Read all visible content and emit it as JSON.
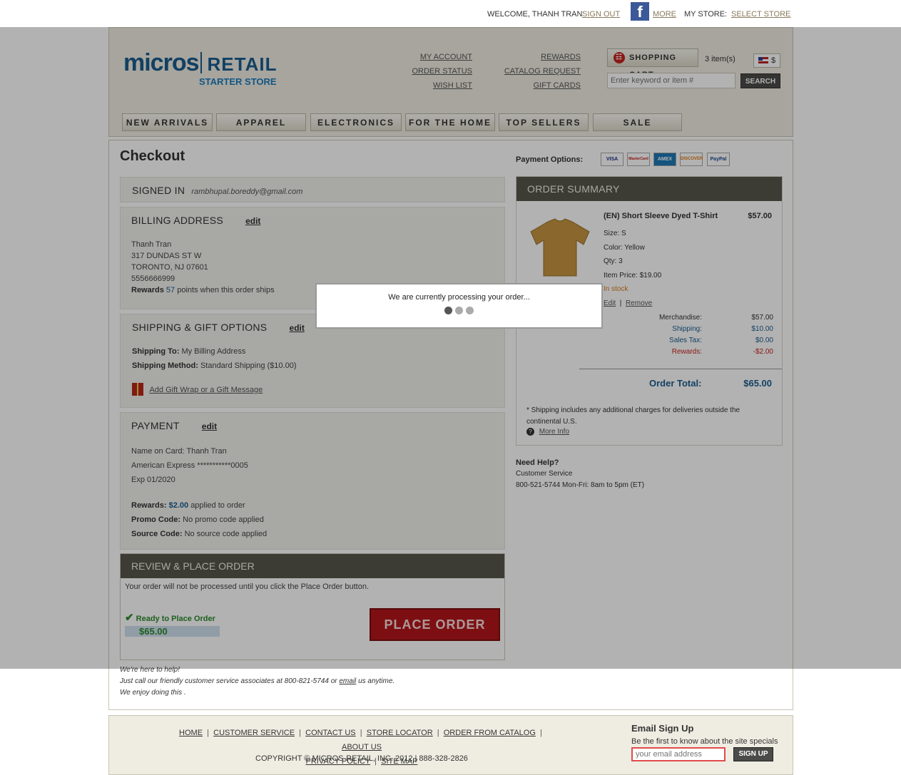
{
  "topbar": {
    "welcome": "WELCOME, THANH TRAN",
    "sign_out": "SIGN OUT",
    "more": "MORE",
    "my_store": "MY STORE:",
    "select_store": "SELECT STORE"
  },
  "header": {
    "logo_main": "micros",
    "logo_retail": "RETAIL",
    "logo_sub": "STARTER STORE",
    "links_left": [
      "MY ACCOUNT",
      "ORDER STATUS",
      "WISH LIST"
    ],
    "links_right": [
      "REWARDS",
      "CATALOG REQUEST",
      "GIFT CARDS"
    ],
    "cart_label": "SHOPPING CART",
    "cart_items": "3 item(s)",
    "currency": "$",
    "search_placeholder": "Enter keyword or item #",
    "search_button": "SEARCH"
  },
  "nav": [
    "NEW ARRIVALS",
    "APPAREL",
    "ELECTRONICS",
    "FOR THE HOME",
    "TOP SELLERS",
    "SALE"
  ],
  "checkout": {
    "title": "Checkout",
    "payment_options_label": "Payment Options:",
    "cards": [
      "VISA",
      "MasterCard",
      "AMEX",
      "DISCOVER",
      "PayPal"
    ],
    "signed_in": {
      "label": "SIGNED IN",
      "email": "rambhupal.boreddy@gmail.com"
    },
    "billing": {
      "title": "BILLING ADDRESS",
      "edit": "edit",
      "lines": [
        "Thanh Tran",
        "317 DUNDAS ST W",
        "TORONTO, NJ 07601",
        "5556666999"
      ],
      "rewards_prefix": "Rewards",
      "rewards_points": "57",
      "rewards_suffix": "points when this order ships"
    },
    "shipping": {
      "title": "SHIPPING & GIFT OPTIONS",
      "edit": "edit",
      "to_label": "Shipping To:",
      "to_value": "My Billing Address",
      "method_label": "Shipping Method:",
      "method_value": "Standard Shipping ($10.00)",
      "gift_link": "Add Gift Wrap or a Gift Message"
    },
    "payment": {
      "title": "PAYMENT",
      "edit": "edit",
      "name_on_card": "Name on Card: Thanh Tran",
      "card": "American Express ***********0005",
      "exp": "Exp 01/2020",
      "rewards_label": "Rewards:",
      "rewards_amount": "$2.00",
      "rewards_suffix": "applied to order",
      "promo_label": "Promo Code:",
      "promo_value": "No promo code applied",
      "source_label": "Source Code:",
      "source_value": "No source code applied"
    },
    "review": {
      "title": "REVIEW & PLACE ORDER",
      "note": "Your order will not be processed until you click the Place Order button.",
      "ready": "Ready to Place Order",
      "total": "$65.00",
      "place_order": "PLACE ORDER"
    }
  },
  "summary": {
    "title": "ORDER SUMMARY",
    "item_name": "(EN) Short Sleeve Dyed T-Shirt",
    "item_price": "$57.00",
    "size": "Size: S",
    "color": "Color: Yellow",
    "qty": "Qty: 3",
    "unit_price": "Item Price: $19.00",
    "stock": "In stock",
    "edit": "Edit",
    "remove": "Remove",
    "rows": [
      {
        "label": "Merchandise:",
        "value": "$57.00"
      },
      {
        "label": "Shipping:",
        "value": "$10.00"
      },
      {
        "label": "Sales Tax:",
        "value": "$0.00"
      },
      {
        "label": "Rewards:",
        "value": "-$2.00"
      }
    ],
    "order_total_label": "Order Total:",
    "order_total_value": "$65.00",
    "note": "* Shipping includes any additional charges for deliveries outside the continental U.S.",
    "more_info": "More Info"
  },
  "help": {
    "title": "Need Help?",
    "line1": "Customer Service",
    "line2": "800-521-5744 Mon-Fri: 8am to 5pm (ET)"
  },
  "foot_msg": {
    "line1": "We're here to help!",
    "line2_pre": "Just call our friendly customer service associates at 800-821-5744 or",
    "line2_link": "email",
    "line2_post": "us anytime.",
    "line3": "We enjoy doing this ."
  },
  "dialog": {
    "message": "We are currently processing your order..."
  },
  "footer": {
    "links1": [
      "HOME",
      "CUSTOMER SERVICE",
      "CONTACT US",
      "STORE LOCATOR",
      "ORDER FROM CATALOG",
      "ABOUT US"
    ],
    "links2": [
      "PRIVACY POLICY",
      "SITE MAP"
    ],
    "copyright": "COPYRIGHT © MICROS-RETAIL, INC. 2012 | 888-328-2826",
    "signup_title": "Email Sign Up",
    "signup_sub": "Be the first to know about the site specials",
    "email_placeholder": "your email address",
    "signup_button": "SIGN UP"
  }
}
